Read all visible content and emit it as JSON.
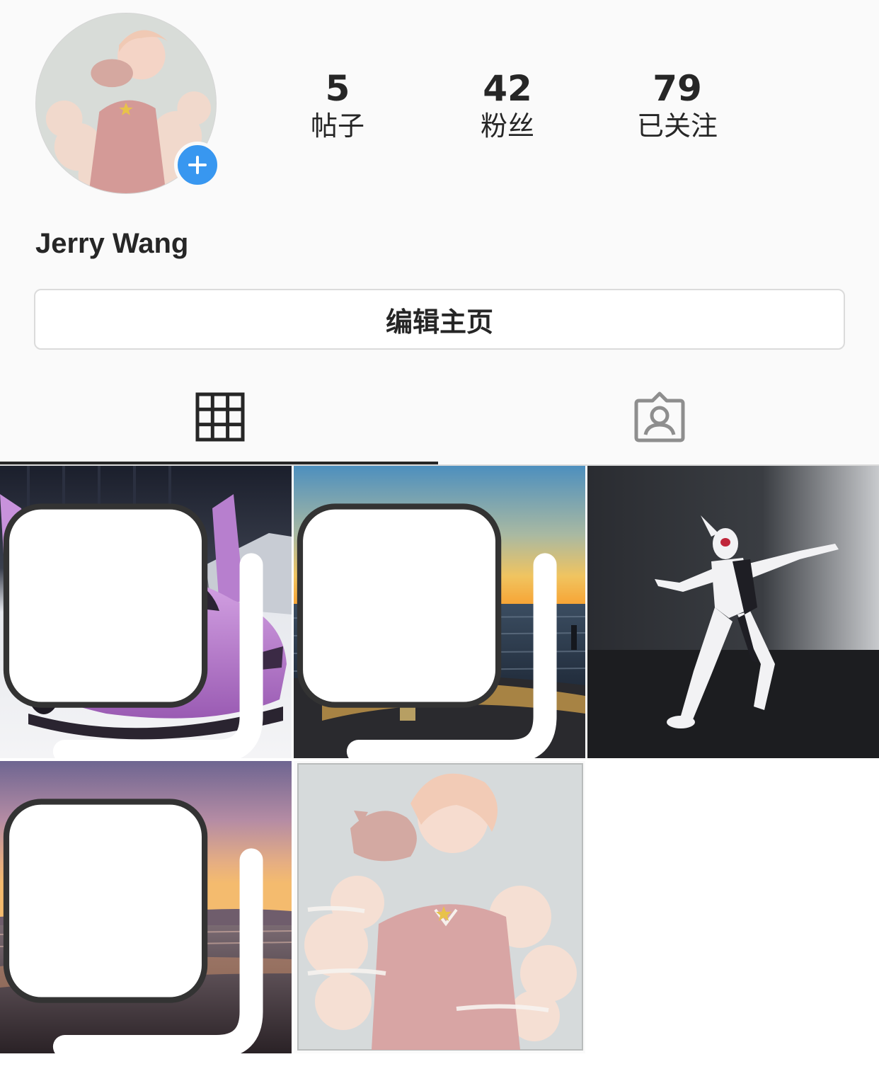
{
  "profile": {
    "name": "Jerry Wang",
    "edit_button_label": "编辑主页",
    "stats": [
      {
        "value": "5",
        "label": "帖子"
      },
      {
        "value": "42",
        "label": "粉丝"
      },
      {
        "value": "79",
        "label": "已关注"
      }
    ],
    "add_story_icon": "plus-icon",
    "accent_color": "#3897f0"
  },
  "tabs": [
    {
      "icon": "grid-icon",
      "selected": true
    },
    {
      "icon": "tagged-person-icon",
      "selected": false
    }
  ],
  "posts": [
    {
      "subject": "purple-sports-car",
      "multi_photo": true
    },
    {
      "subject": "beach-sunset",
      "multi_photo": true
    },
    {
      "subject": "action-figure",
      "multi_photo": false
    },
    {
      "subject": "purple-dusk-beach",
      "multi_photo": true
    },
    {
      "subject": "anime-boy-with-cat",
      "multi_photo": false
    }
  ]
}
